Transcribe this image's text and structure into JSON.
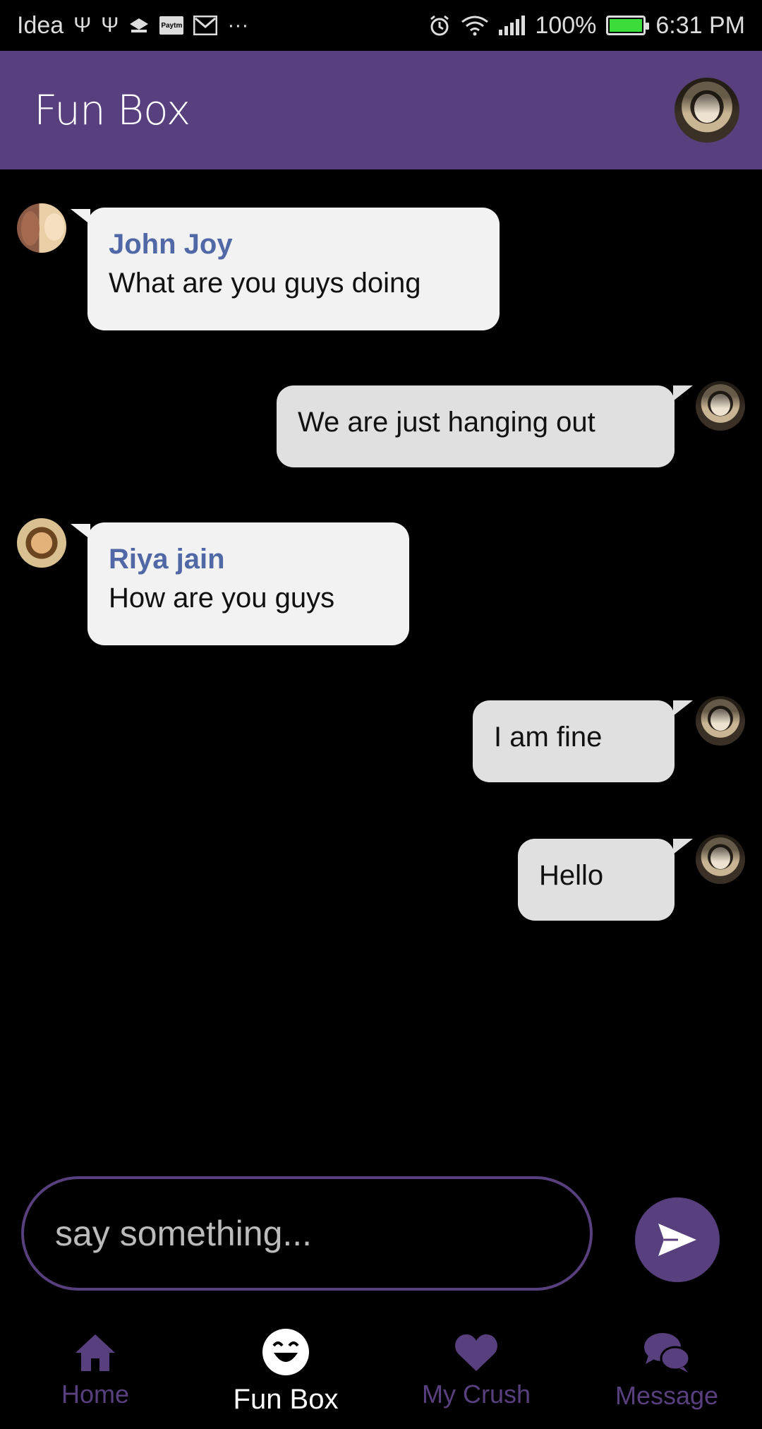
{
  "status_bar": {
    "carrier": "Idea",
    "battery": "100%",
    "time": "6:31 PM",
    "left_icons": [
      "usb-icon",
      "usb-icon",
      "notification-icon",
      "paytm-icon",
      "gmail-icon",
      "more-icon"
    ],
    "right_icons": [
      "alarm-icon",
      "wifi-icon",
      "signal-icon",
      "battery-icon"
    ],
    "paytm_label": "Paytm",
    "more": "···"
  },
  "app_bar": {
    "title": "Fun Box"
  },
  "messages": [
    {
      "direction": "in",
      "sender": "John Joy",
      "text": "What are you guys doing"
    },
    {
      "direction": "out",
      "text": "We are just hanging out"
    },
    {
      "direction": "in",
      "sender": "Riya jain",
      "text": "How are you guys"
    },
    {
      "direction": "out",
      "text": "I am fine"
    },
    {
      "direction": "out",
      "text": "Hello"
    }
  ],
  "composer": {
    "placeholder": "say something...",
    "value": ""
  },
  "nav": {
    "items": [
      {
        "label": "Home",
        "icon": "home-icon",
        "active": false
      },
      {
        "label": "Fun Box",
        "icon": "laughing-face-icon",
        "active": true
      },
      {
        "label": "My Crush",
        "icon": "heart-icon",
        "active": false
      },
      {
        "label": "Message",
        "icon": "chat-bubbles-icon",
        "active": false
      }
    ]
  },
  "colors": {
    "primary": "#583f7d",
    "sender_name": "#5069a6",
    "incoming_bubble": "#f2f2f2",
    "outgoing_bubble": "#e0e0e0",
    "battery": "#3ddc3d"
  }
}
